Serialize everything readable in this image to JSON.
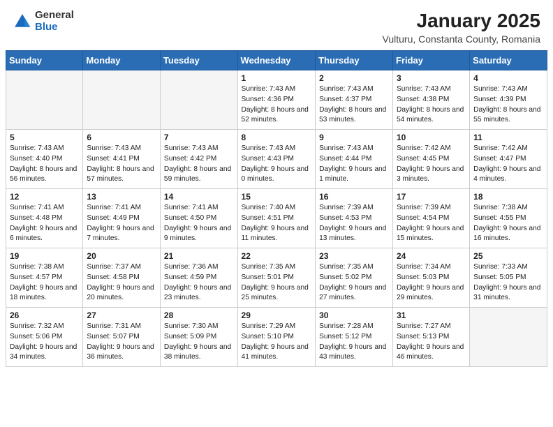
{
  "header": {
    "logo_general": "General",
    "logo_blue": "Blue",
    "month_title": "January 2025",
    "location": "Vulturu, Constanta County, Romania"
  },
  "weekdays": [
    "Sunday",
    "Monday",
    "Tuesday",
    "Wednesday",
    "Thursday",
    "Friday",
    "Saturday"
  ],
  "weeks": [
    [
      {
        "day": "",
        "info": ""
      },
      {
        "day": "",
        "info": ""
      },
      {
        "day": "",
        "info": ""
      },
      {
        "day": "1",
        "info": "Sunrise: 7:43 AM\nSunset: 4:36 PM\nDaylight: 8 hours and 52 minutes."
      },
      {
        "day": "2",
        "info": "Sunrise: 7:43 AM\nSunset: 4:37 PM\nDaylight: 8 hours and 53 minutes."
      },
      {
        "day": "3",
        "info": "Sunrise: 7:43 AM\nSunset: 4:38 PM\nDaylight: 8 hours and 54 minutes."
      },
      {
        "day": "4",
        "info": "Sunrise: 7:43 AM\nSunset: 4:39 PM\nDaylight: 8 hours and 55 minutes."
      }
    ],
    [
      {
        "day": "5",
        "info": "Sunrise: 7:43 AM\nSunset: 4:40 PM\nDaylight: 8 hours and 56 minutes."
      },
      {
        "day": "6",
        "info": "Sunrise: 7:43 AM\nSunset: 4:41 PM\nDaylight: 8 hours and 57 minutes."
      },
      {
        "day": "7",
        "info": "Sunrise: 7:43 AM\nSunset: 4:42 PM\nDaylight: 8 hours and 59 minutes."
      },
      {
        "day": "8",
        "info": "Sunrise: 7:43 AM\nSunset: 4:43 PM\nDaylight: 9 hours and 0 minutes."
      },
      {
        "day": "9",
        "info": "Sunrise: 7:43 AM\nSunset: 4:44 PM\nDaylight: 9 hours and 1 minute."
      },
      {
        "day": "10",
        "info": "Sunrise: 7:42 AM\nSunset: 4:45 PM\nDaylight: 9 hours and 3 minutes."
      },
      {
        "day": "11",
        "info": "Sunrise: 7:42 AM\nSunset: 4:47 PM\nDaylight: 9 hours and 4 minutes."
      }
    ],
    [
      {
        "day": "12",
        "info": "Sunrise: 7:41 AM\nSunset: 4:48 PM\nDaylight: 9 hours and 6 minutes."
      },
      {
        "day": "13",
        "info": "Sunrise: 7:41 AM\nSunset: 4:49 PM\nDaylight: 9 hours and 7 minutes."
      },
      {
        "day": "14",
        "info": "Sunrise: 7:41 AM\nSunset: 4:50 PM\nDaylight: 9 hours and 9 minutes."
      },
      {
        "day": "15",
        "info": "Sunrise: 7:40 AM\nSunset: 4:51 PM\nDaylight: 9 hours and 11 minutes."
      },
      {
        "day": "16",
        "info": "Sunrise: 7:39 AM\nSunset: 4:53 PM\nDaylight: 9 hours and 13 minutes."
      },
      {
        "day": "17",
        "info": "Sunrise: 7:39 AM\nSunset: 4:54 PM\nDaylight: 9 hours and 15 minutes."
      },
      {
        "day": "18",
        "info": "Sunrise: 7:38 AM\nSunset: 4:55 PM\nDaylight: 9 hours and 16 minutes."
      }
    ],
    [
      {
        "day": "19",
        "info": "Sunrise: 7:38 AM\nSunset: 4:57 PM\nDaylight: 9 hours and 18 minutes."
      },
      {
        "day": "20",
        "info": "Sunrise: 7:37 AM\nSunset: 4:58 PM\nDaylight: 9 hours and 20 minutes."
      },
      {
        "day": "21",
        "info": "Sunrise: 7:36 AM\nSunset: 4:59 PM\nDaylight: 9 hours and 23 minutes."
      },
      {
        "day": "22",
        "info": "Sunrise: 7:35 AM\nSunset: 5:01 PM\nDaylight: 9 hours and 25 minutes."
      },
      {
        "day": "23",
        "info": "Sunrise: 7:35 AM\nSunset: 5:02 PM\nDaylight: 9 hours and 27 minutes."
      },
      {
        "day": "24",
        "info": "Sunrise: 7:34 AM\nSunset: 5:03 PM\nDaylight: 9 hours and 29 minutes."
      },
      {
        "day": "25",
        "info": "Sunrise: 7:33 AM\nSunset: 5:05 PM\nDaylight: 9 hours and 31 minutes."
      }
    ],
    [
      {
        "day": "26",
        "info": "Sunrise: 7:32 AM\nSunset: 5:06 PM\nDaylight: 9 hours and 34 minutes."
      },
      {
        "day": "27",
        "info": "Sunrise: 7:31 AM\nSunset: 5:07 PM\nDaylight: 9 hours and 36 minutes."
      },
      {
        "day": "28",
        "info": "Sunrise: 7:30 AM\nSunset: 5:09 PM\nDaylight: 9 hours and 38 minutes."
      },
      {
        "day": "29",
        "info": "Sunrise: 7:29 AM\nSunset: 5:10 PM\nDaylight: 9 hours and 41 minutes."
      },
      {
        "day": "30",
        "info": "Sunrise: 7:28 AM\nSunset: 5:12 PM\nDaylight: 9 hours and 43 minutes."
      },
      {
        "day": "31",
        "info": "Sunrise: 7:27 AM\nSunset: 5:13 PM\nDaylight: 9 hours and 46 minutes."
      },
      {
        "day": "",
        "info": ""
      }
    ]
  ]
}
